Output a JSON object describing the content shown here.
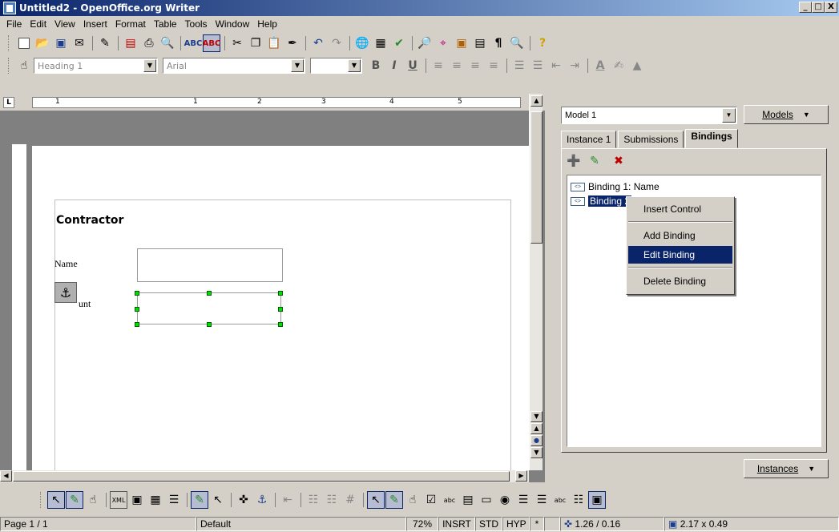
{
  "window": {
    "title": "Untitled2 - OpenOffice.org Writer",
    "min": "_",
    "max": "□",
    "close": "X"
  },
  "menu": [
    "File",
    "Edit",
    "View",
    "Insert",
    "Format",
    "Table",
    "Tools",
    "Window",
    "Help"
  ],
  "format_toolbar": {
    "style": "Heading 1",
    "font": "Arial",
    "size": "",
    "bold": "B",
    "italic": "I",
    "underline": "U"
  },
  "ruler": {
    "marks": [
      "1",
      "1",
      "2",
      "3",
      "4",
      "5"
    ]
  },
  "document": {
    "heading": "Contractor",
    "name_label": "Name",
    "amount_label": "unt"
  },
  "panel": {
    "model": "Model 1",
    "models_button": "Models",
    "tabs": [
      "Instance 1",
      "Submissions",
      "Bindings"
    ],
    "bindings": [
      "Binding 1: Name",
      "Binding 2"
    ],
    "instances_button": "Instances"
  },
  "context_menu": {
    "items": [
      "Insert Control",
      "Add Binding",
      "Edit Binding",
      "Delete Binding"
    ],
    "highlighted": "Edit Binding"
  },
  "status": {
    "page": "Page 1 / 1",
    "style": "Default",
    "zoom": "72%",
    "insert_mode": "INSRT",
    "selection_mode": "STD",
    "hyphenation": "HYP",
    "modified": "*",
    "position": "1.26 / 0.16",
    "size": "2.17 x 0.49"
  }
}
